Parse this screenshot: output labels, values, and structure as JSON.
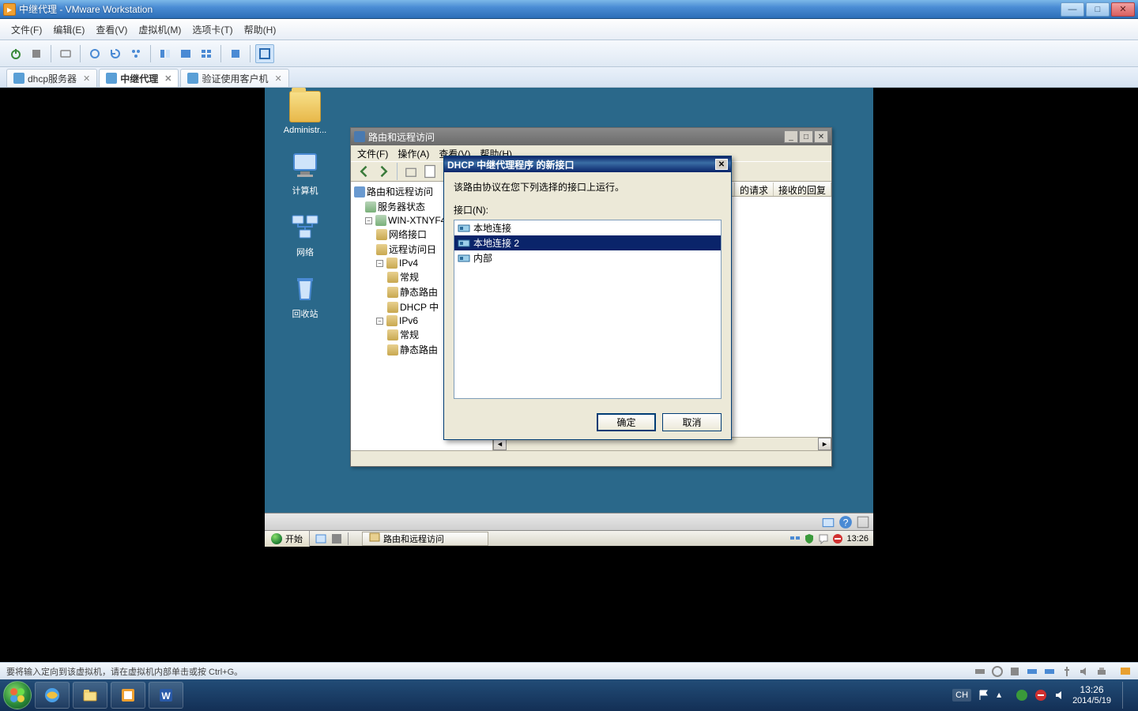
{
  "host": {
    "title": "中继代理 - VMware Workstation",
    "menu": [
      "文件(F)",
      "编辑(E)",
      "查看(V)",
      "虚拟机(M)",
      "选项卡(T)",
      "帮助(H)"
    ],
    "tabs": [
      {
        "label": "dhcp服务器",
        "active": false
      },
      {
        "label": "中继代理",
        "active": true
      },
      {
        "label": "验证使用客户机",
        "active": false
      }
    ],
    "statusbar": "要将输入定向到该虚拟机，请在虚拟机内部单击或按 Ctrl+G。",
    "win7_time": "13:26",
    "win7_date": "2014/5/19",
    "lang": "CH"
  },
  "guest": {
    "desktop_icons": [
      {
        "name": "Administr..."
      },
      {
        "name": "计算机"
      },
      {
        "name": "网络"
      },
      {
        "name": "回收站"
      }
    ],
    "mmc": {
      "title": "路由和远程访问",
      "menu": [
        "文件(F)",
        "操作(A)",
        "查看(V)",
        "帮助(H)"
      ],
      "tree": {
        "root": "路由和远程访问",
        "server_status": "服务器状态",
        "server": "WIN-XTNYF465Y",
        "nodes": {
          "net_if": "网络接口",
          "remote_log": "远程访问日",
          "ipv4": "IPv4",
          "ipv4_general": "常规",
          "ipv4_static": "静态路由",
          "ipv4_dhcp": "DHCP 中",
          "ipv6": "IPv6",
          "ipv6_general": "常规",
          "ipv6_static": "静态路由"
        }
      },
      "list_headers": [
        "的请求",
        "接收的回复"
      ]
    },
    "dialog": {
      "title": "DHCP 中继代理程序 的新接口",
      "desc": "该路由协议在您下列选择的接口上运行。",
      "list_label": "接口(N):",
      "items": [
        {
          "label": "本地连接",
          "selected": false
        },
        {
          "label": "本地连接 2",
          "selected": true
        },
        {
          "label": "内部",
          "selected": false
        }
      ],
      "ok": "确定",
      "cancel": "取消"
    },
    "taskbar": {
      "start": "开始",
      "task": "路由和远程访问",
      "time": "13:26"
    }
  }
}
